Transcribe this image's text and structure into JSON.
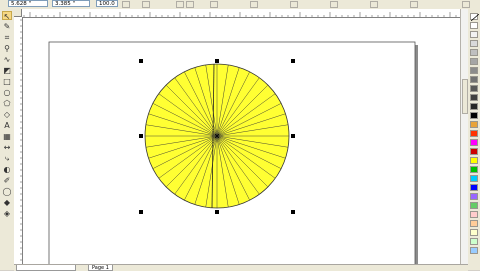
{
  "property_bar": {
    "x_position": "5.628 \"",
    "y_position": "3.385 \"",
    "scale": "100.0"
  },
  "page_tabs": [
    "Page 1"
  ],
  "palette_colors": [
    "#ffffff",
    "#f2f2f2",
    "#d9d9d9",
    "#bfbfbf",
    "#a6a6a6",
    "#8c8c8c",
    "#737373",
    "#595959",
    "#404040",
    "#262626",
    "#000000",
    "#e8a33a",
    "#ff3300",
    "#ff00ff",
    "#cc0000",
    "#ffff00",
    "#00c000",
    "#00ccff",
    "#0000ff",
    "#9966ff",
    "#66cc66",
    "#ffcccc",
    "#ffcc99",
    "#ffffcc",
    "#ccffcc",
    "#99ccff"
  ],
  "shape": {
    "fill": "#ffff33",
    "stroke": "#333333",
    "spoke_count": 40
  }
}
